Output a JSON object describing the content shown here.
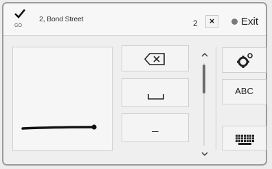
{
  "header": {
    "go_label": "GO",
    "address": "2, Bond Street",
    "cursor_text": "2",
    "clear_label": "×",
    "exit_label": "Exit"
  },
  "keys": {
    "underscore_label": "_",
    "abc_label": "ABC"
  },
  "scroll": {
    "up_icon": "chevron-up",
    "down_icon": "chevron-down"
  },
  "icons": {
    "go": "check-icon",
    "exit": "circle-icon",
    "backspace": "backspace-icon",
    "space": "space-icon",
    "settings": "gear-icon",
    "keyboard": "keyboard-icon"
  }
}
